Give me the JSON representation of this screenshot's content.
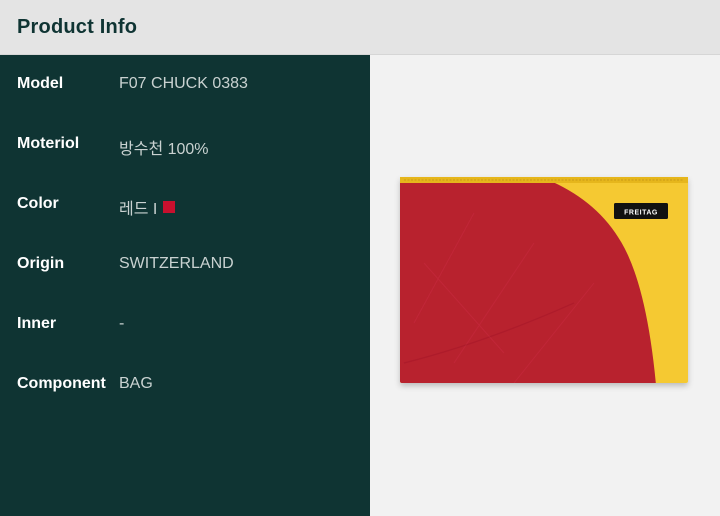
{
  "header": {
    "title": "Product Info"
  },
  "specs": [
    {
      "label": "Model",
      "value": "F07 CHUCK 0383"
    },
    {
      "label": "Moteriol",
      "value": "방수천 100%"
    },
    {
      "label": "Color",
      "value": "레드 I",
      "swatch_color": "#c8102e"
    },
    {
      "label": "Origin",
      "value": "SWITZERLAND"
    },
    {
      "label": "Inner",
      "value": "-"
    },
    {
      "label": "Component",
      "value": "BAG"
    }
  ],
  "product": {
    "brand_tag": "FREITAG",
    "colors": {
      "body": "#f5c932",
      "panel": "#b8202f",
      "tag": "#111111"
    }
  },
  "theme": {
    "panel_bg": "#0f3433",
    "header_bg": "#e4e4e4",
    "image_bg": "#f2f2f2"
  }
}
